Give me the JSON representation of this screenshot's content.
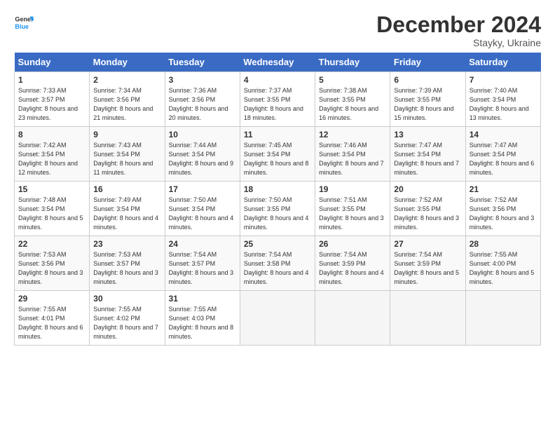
{
  "header": {
    "logo_line1": "General",
    "logo_line2": "Blue",
    "month": "December 2024",
    "location": "Stayky, Ukraine"
  },
  "days_of_week": [
    "Sunday",
    "Monday",
    "Tuesday",
    "Wednesday",
    "Thursday",
    "Friday",
    "Saturday"
  ],
  "weeks": [
    [
      {
        "num": "1",
        "sunrise": "7:33 AM",
        "sunset": "3:57 PM",
        "daylight": "8 hours and 23 minutes."
      },
      {
        "num": "2",
        "sunrise": "7:34 AM",
        "sunset": "3:56 PM",
        "daylight": "8 hours and 21 minutes."
      },
      {
        "num": "3",
        "sunrise": "7:36 AM",
        "sunset": "3:56 PM",
        "daylight": "8 hours and 20 minutes."
      },
      {
        "num": "4",
        "sunrise": "7:37 AM",
        "sunset": "3:55 PM",
        "daylight": "8 hours and 18 minutes."
      },
      {
        "num": "5",
        "sunrise": "7:38 AM",
        "sunset": "3:55 PM",
        "daylight": "8 hours and 16 minutes."
      },
      {
        "num": "6",
        "sunrise": "7:39 AM",
        "sunset": "3:55 PM",
        "daylight": "8 hours and 15 minutes."
      },
      {
        "num": "7",
        "sunrise": "7:40 AM",
        "sunset": "3:54 PM",
        "daylight": "8 hours and 13 minutes."
      }
    ],
    [
      {
        "num": "8",
        "sunrise": "7:42 AM",
        "sunset": "3:54 PM",
        "daylight": "8 hours and 12 minutes."
      },
      {
        "num": "9",
        "sunrise": "7:43 AM",
        "sunset": "3:54 PM",
        "daylight": "8 hours and 11 minutes."
      },
      {
        "num": "10",
        "sunrise": "7:44 AM",
        "sunset": "3:54 PM",
        "daylight": "8 hours and 9 minutes."
      },
      {
        "num": "11",
        "sunrise": "7:45 AM",
        "sunset": "3:54 PM",
        "daylight": "8 hours and 8 minutes."
      },
      {
        "num": "12",
        "sunrise": "7:46 AM",
        "sunset": "3:54 PM",
        "daylight": "8 hours and 7 minutes."
      },
      {
        "num": "13",
        "sunrise": "7:47 AM",
        "sunset": "3:54 PM",
        "daylight": "8 hours and 7 minutes."
      },
      {
        "num": "14",
        "sunrise": "7:47 AM",
        "sunset": "3:54 PM",
        "daylight": "8 hours and 6 minutes."
      }
    ],
    [
      {
        "num": "15",
        "sunrise": "7:48 AM",
        "sunset": "3:54 PM",
        "daylight": "8 hours and 5 minutes."
      },
      {
        "num": "16",
        "sunrise": "7:49 AM",
        "sunset": "3:54 PM",
        "daylight": "8 hours and 4 minutes."
      },
      {
        "num": "17",
        "sunrise": "7:50 AM",
        "sunset": "3:54 PM",
        "daylight": "8 hours and 4 minutes."
      },
      {
        "num": "18",
        "sunrise": "7:50 AM",
        "sunset": "3:55 PM",
        "daylight": "8 hours and 4 minutes."
      },
      {
        "num": "19",
        "sunrise": "7:51 AM",
        "sunset": "3:55 PM",
        "daylight": "8 hours and 3 minutes."
      },
      {
        "num": "20",
        "sunrise": "7:52 AM",
        "sunset": "3:55 PM",
        "daylight": "8 hours and 3 minutes."
      },
      {
        "num": "21",
        "sunrise": "7:52 AM",
        "sunset": "3:56 PM",
        "daylight": "8 hours and 3 minutes."
      }
    ],
    [
      {
        "num": "22",
        "sunrise": "7:53 AM",
        "sunset": "3:56 PM",
        "daylight": "8 hours and 3 minutes."
      },
      {
        "num": "23",
        "sunrise": "7:53 AM",
        "sunset": "3:57 PM",
        "daylight": "8 hours and 3 minutes."
      },
      {
        "num": "24",
        "sunrise": "7:54 AM",
        "sunset": "3:57 PM",
        "daylight": "8 hours and 3 minutes."
      },
      {
        "num": "25",
        "sunrise": "7:54 AM",
        "sunset": "3:58 PM",
        "daylight": "8 hours and 4 minutes."
      },
      {
        "num": "26",
        "sunrise": "7:54 AM",
        "sunset": "3:59 PM",
        "daylight": "8 hours and 4 minutes."
      },
      {
        "num": "27",
        "sunrise": "7:54 AM",
        "sunset": "3:59 PM",
        "daylight": "8 hours and 5 minutes."
      },
      {
        "num": "28",
        "sunrise": "7:55 AM",
        "sunset": "4:00 PM",
        "daylight": "8 hours and 5 minutes."
      }
    ],
    [
      {
        "num": "29",
        "sunrise": "7:55 AM",
        "sunset": "4:01 PM",
        "daylight": "8 hours and 6 minutes."
      },
      {
        "num": "30",
        "sunrise": "7:55 AM",
        "sunset": "4:02 PM",
        "daylight": "8 hours and 7 minutes."
      },
      {
        "num": "31",
        "sunrise": "7:55 AM",
        "sunset": "4:03 PM",
        "daylight": "8 hours and 8 minutes."
      },
      null,
      null,
      null,
      null
    ]
  ],
  "labels": {
    "sunrise": "Sunrise:",
    "sunset": "Sunset:",
    "daylight": "Daylight:"
  }
}
